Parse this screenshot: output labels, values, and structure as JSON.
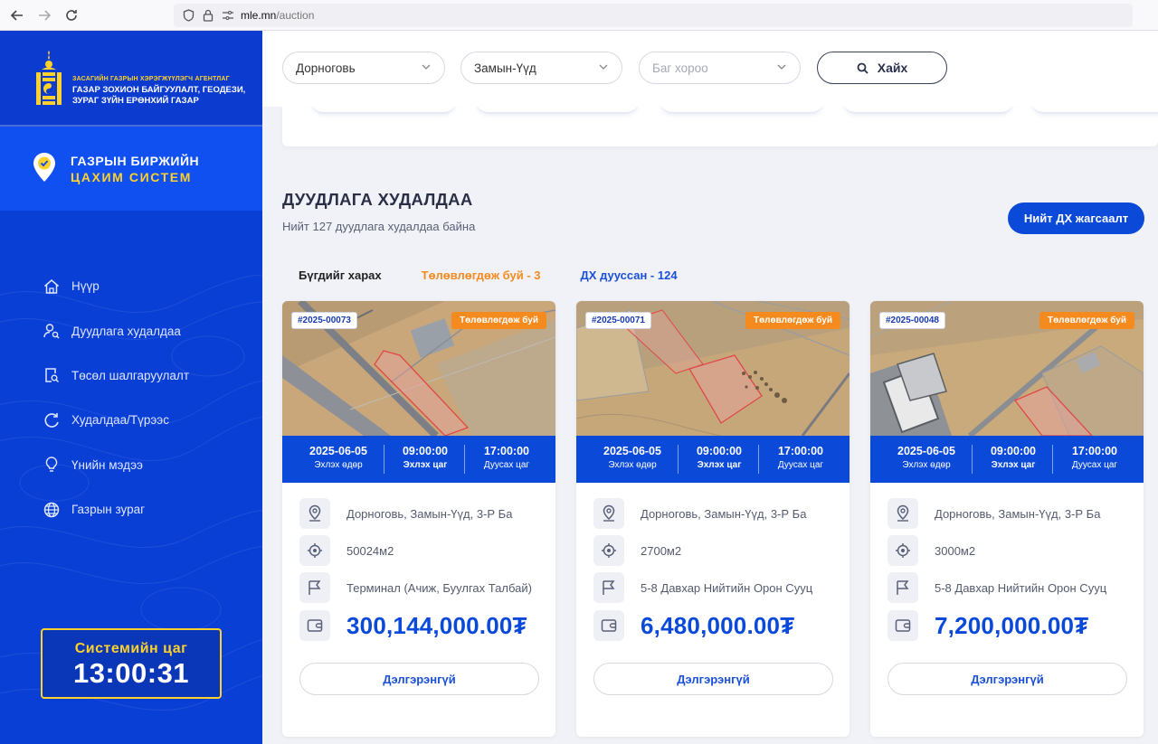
{
  "browser": {
    "url_host": "mle.mn",
    "url_path": "/auction"
  },
  "sidebar": {
    "agency_small": "ЗАСАГИЙН ГАЗРЫН ХЭРЭГЖҮҮЛЭГЧ АГЕНТЛАГ",
    "agency_line1": "ГАЗАР ЗОХИОН БАЙГУУЛАЛТ, ГЕОДЕЗИ,",
    "agency_line2": "ЗУРАГ ЗҮЙН ЕРӨНХИЙ ГАЗАР",
    "system_title1": "ГАЗРЫН БИРЖИЙН",
    "system_title2": "ЦАХИМ СИСТЕМ",
    "menu": [
      {
        "label": "Нүүр",
        "icon": "home-icon"
      },
      {
        "label": "Дуудлага худалдаа",
        "icon": "user-search-icon"
      },
      {
        "label": "Төсөл шалгаруулалт",
        "icon": "document-search-icon"
      },
      {
        "label": "Худалдаа/Түрээс",
        "icon": "refresh-icon"
      },
      {
        "label": "Үнийн мэдээ",
        "icon": "lightbulb-icon"
      },
      {
        "label": "Газрын зураг",
        "icon": "globe-icon"
      }
    ],
    "clock_label": "Системийн цаг",
    "clock_time": "13:00:31"
  },
  "filters": {
    "aimag": "Дорноговь",
    "sum": "Замын-Үүд",
    "bag_placeholder": "Баг хороо",
    "search_label": "Хайх"
  },
  "section": {
    "title": "ДУУДЛАГА ХУДАЛДАА",
    "subtitle": "Нийт 127 дуудлага худалдаа байна",
    "all_button": "Нийт ДХ жагсаалт",
    "tabs": [
      "Бүгдийг харах",
      "Төлөвлөгдөж буй - 3",
      "ДХ дууссан - 124"
    ]
  },
  "card_labels": {
    "start_date": "Эхлэх өдөр",
    "start_time": "Эхлэх цаг",
    "end_time": "Дуусах цаг",
    "detail": "Дэлгэрэнгүй"
  },
  "cards": [
    {
      "id": "#2025-00073",
      "status": "Төлөвлөгдөж буй",
      "date": "2025-06-05",
      "start": "09:00:00",
      "end": "17:00:00",
      "location": "Дорноговь, Замын-Үүд, 3-Р Ба",
      "area": "50024м2",
      "purpose": "Терминал (Ачиж, Буулгах Талбай)",
      "price": "300,144,000.00₮"
    },
    {
      "id": "#2025-00071",
      "status": "Төлөвлөгдөж буй",
      "date": "2025-06-05",
      "start": "09:00:00",
      "end": "17:00:00",
      "location": "Дорноговь, Замын-Үүд, 3-Р Ба",
      "area": "2700м2",
      "purpose": "5-8 Давхар Нийтийн Орон Сууц",
      "price": "6,480,000.00₮"
    },
    {
      "id": "#2025-00048",
      "status": "Төлөвлөгдөж буй",
      "date": "2025-06-05",
      "start": "09:00:00",
      "end": "17:00:00",
      "location": "Дорноговь, Замын-Үүд, 3-Р Ба",
      "area": "3000м2",
      "purpose": "5-8 Давхар Нийтийн Орон Сууц",
      "price": "7,200,000.00₮"
    }
  ],
  "colors": {
    "sidebar_blue": "#0a3fd6",
    "accent_blue": "#0b49d9",
    "accent_yellow": "#ffd12a",
    "status_orange": "#f58a1f"
  }
}
